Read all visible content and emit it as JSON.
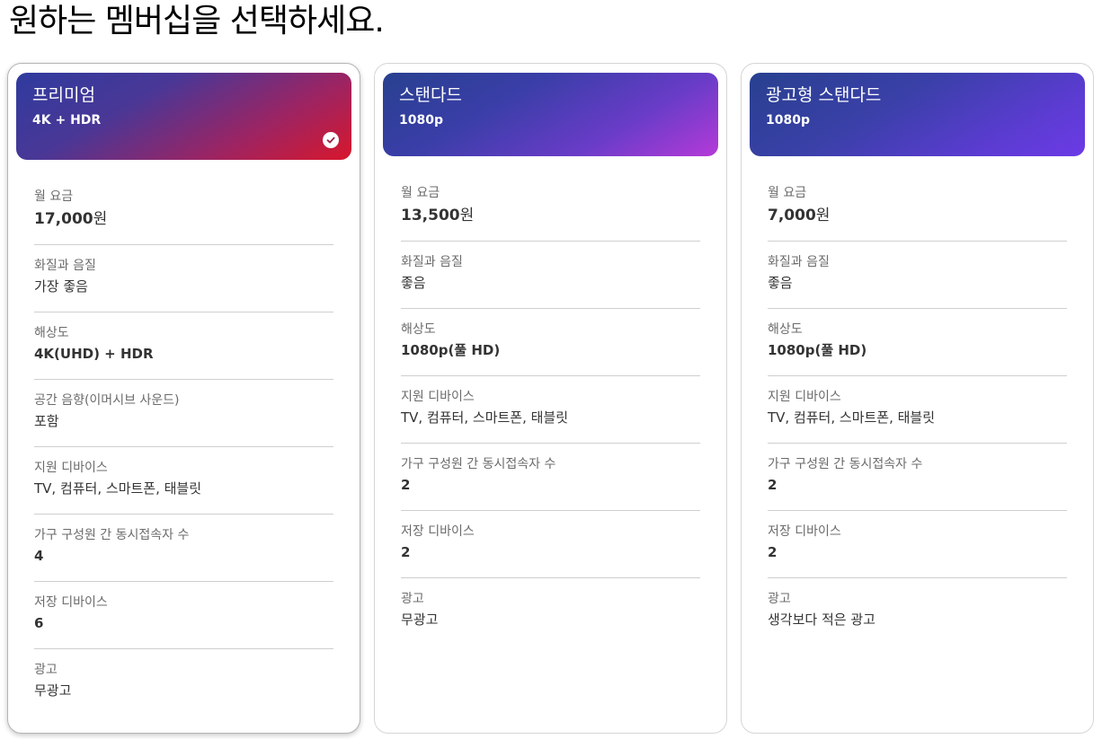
{
  "page": {
    "title": "원하는 멤버십을 선택하세요."
  },
  "colors": {
    "premium_gradient": [
      "#3338a0",
      "#8a2a6a",
      "#d3172f"
    ],
    "standard_gradient": [
      "#2a3a95",
      "#5a3fc0",
      "#b23ad8"
    ],
    "basic_ads_gradient": [
      "#2a3a95",
      "#4a3fc0",
      "#6c3ae0"
    ],
    "divider": "#cfcfcf"
  },
  "plans": [
    {
      "name": "프리미엄",
      "resolution_short": "4K + HDR",
      "selected": true,
      "check_icon": "check-circle-icon",
      "attrs": {
        "price_label": "월 요금",
        "price_value": "17,000",
        "price_unit": "원",
        "quality_label": "화질과 음질",
        "quality_value": "가장 좋음",
        "resolution_label": "해상도",
        "resolution_value": "4K(UHD) + HDR",
        "spatial_label": "공간 음향(이머시브 사운드)",
        "spatial_value": "포함",
        "devices_label": "지원 디바이스",
        "devices_value": "TV, 컴퓨터, 스마트폰, 태블릿",
        "streams_label": "가구 구성원 간 동시접속자 수",
        "streams_value": "4",
        "download_label": "저장 디바이스",
        "download_value": "6",
        "ads_label": "광고",
        "ads_value": "무광고"
      }
    },
    {
      "name": "스탠다드",
      "resolution_short": "1080p",
      "selected": false,
      "attrs": {
        "price_label": "월 요금",
        "price_value": "13,500",
        "price_unit": "원",
        "quality_label": "화질과 음질",
        "quality_value": "좋음",
        "resolution_label": "해상도",
        "resolution_value": "1080p(풀 HD)",
        "devices_label": "지원 디바이스",
        "devices_value": "TV, 컴퓨터, 스마트폰, 태블릿",
        "streams_label": "가구 구성원 간 동시접속자 수",
        "streams_value": "2",
        "download_label": "저장 디바이스",
        "download_value": "2",
        "ads_label": "광고",
        "ads_value": "무광고"
      }
    },
    {
      "name": "광고형 스탠다드",
      "resolution_short": "1080p",
      "selected": false,
      "attrs": {
        "price_label": "월 요금",
        "price_value": "7,000",
        "price_unit": "원",
        "quality_label": "화질과 음질",
        "quality_value": "좋음",
        "resolution_label": "해상도",
        "resolution_value": "1080p(풀 HD)",
        "devices_label": "지원 디바이스",
        "devices_value": "TV, 컴퓨터, 스마트폰, 태블릿",
        "streams_label": "가구 구성원 간 동시접속자 수",
        "streams_value": "2",
        "download_label": "저장 디바이스",
        "download_value": "2",
        "ads_label": "광고",
        "ads_value": "생각보다 적은 광고"
      }
    }
  ]
}
